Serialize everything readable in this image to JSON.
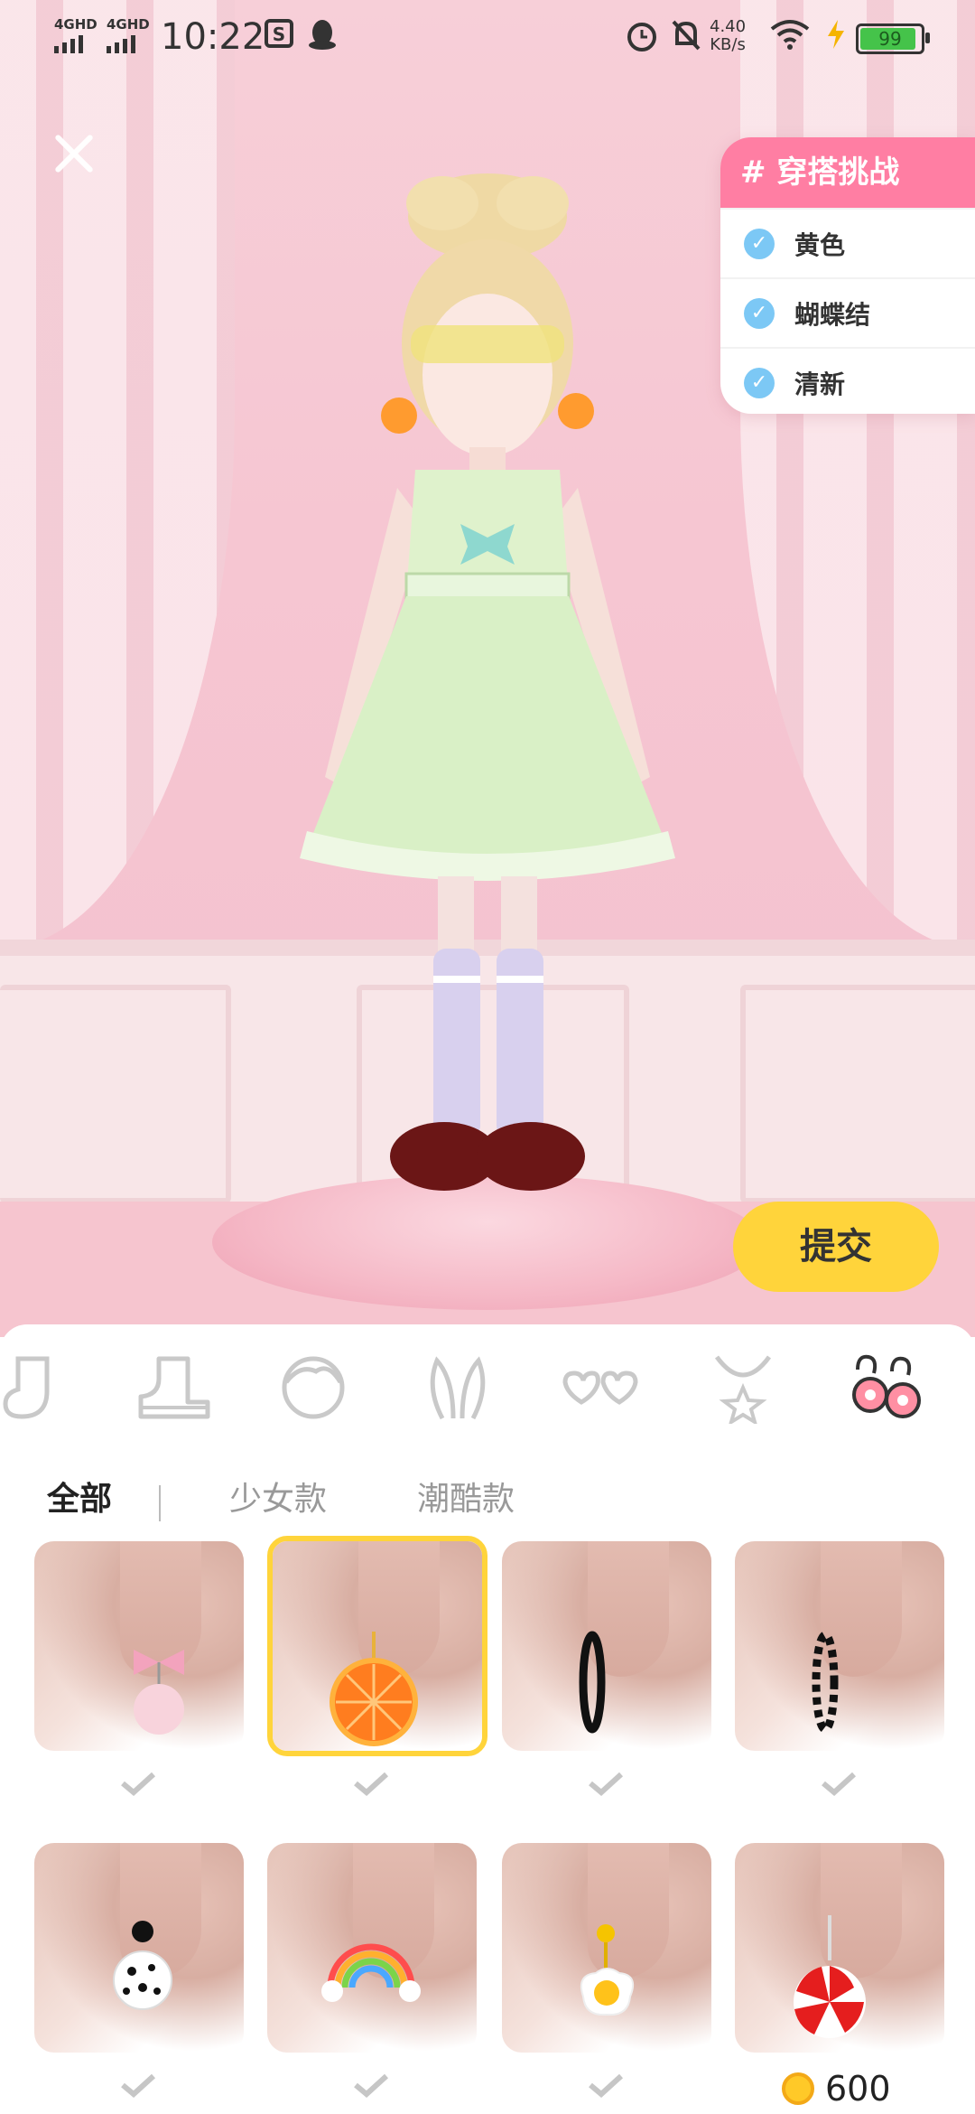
{
  "status_bar": {
    "signal1": "4GHD",
    "signal2": "4GHD",
    "time": "10:22",
    "net_speed_value": "4.40",
    "net_speed_unit": "KB/s",
    "battery": "99",
    "icons": [
      "s-app-icon",
      "qq-penguin-icon",
      "alarm-icon",
      "mute-bell-icon",
      "wifi-icon",
      "charging-icon"
    ]
  },
  "challenge": {
    "title": "# 穿搭挑战",
    "items": [
      {
        "label": "黄色",
        "checked": true
      },
      {
        "label": "蝴蝶结",
        "checked": true
      },
      {
        "label": "清新",
        "checked": true
      }
    ]
  },
  "submit_label": "提交",
  "categories": [
    "socks-icon",
    "shoe-icon",
    "face-icon",
    "bunny-ears-icon",
    "heart-glasses-icon",
    "necklace-icon",
    "earrings-icon"
  ],
  "active_category": "earrings-icon",
  "filter_tabs": [
    {
      "label": "全部",
      "active": true
    },
    {
      "label": "少女款",
      "active": false
    },
    {
      "label": "潮酷款",
      "active": false
    }
  ],
  "items": [
    {
      "name": "pink-bow-pompom-earring",
      "selected": false,
      "owned": true
    },
    {
      "name": "orange-slice-earring",
      "selected": true,
      "owned": true
    },
    {
      "name": "black-hoop-earring",
      "selected": false,
      "owned": true
    },
    {
      "name": "zebra-hoop-earring",
      "selected": false,
      "owned": true
    },
    {
      "name": "dalmatian-ball-earring",
      "selected": false,
      "owned": true
    },
    {
      "name": "rainbow-earring",
      "selected": false,
      "owned": true
    },
    {
      "name": "fried-egg-earring",
      "selected": false,
      "owned": true
    },
    {
      "name": "peppermint-candy-earring",
      "selected": false,
      "owned": false
    }
  ],
  "price": "600",
  "colors": {
    "accent_yellow": "#ffd43b",
    "challenge_pink": "#ff7ea3",
    "check_blue": "#7cc8f5"
  }
}
